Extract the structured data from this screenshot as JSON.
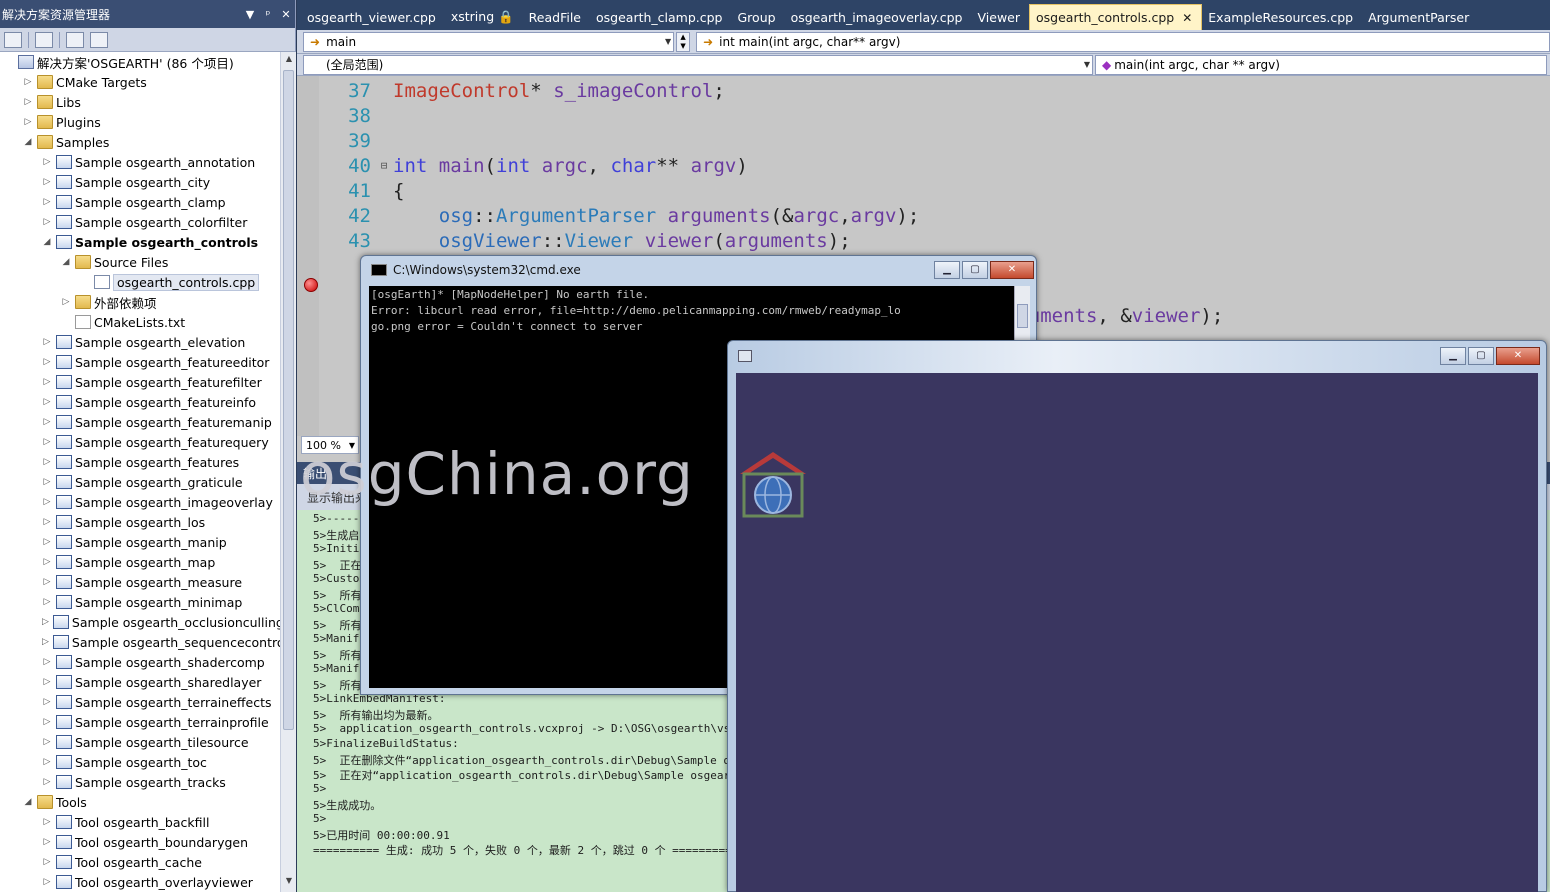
{
  "explorer": {
    "title": "解决方案资源管理器",
    "pin": "▼",
    "dock": "ᵖ",
    "close": "✕",
    "items": [
      {
        "text": "解决方案'OSGEARTH' (86 个项目)",
        "indent": 0,
        "arrow": "",
        "icon": "sln",
        "bold": false
      },
      {
        "text": "CMake Targets",
        "indent": 1,
        "arrow": "▷",
        "icon": "folder",
        "bold": false
      },
      {
        "text": "Libs",
        "indent": 1,
        "arrow": "▷",
        "icon": "folder",
        "bold": false
      },
      {
        "text": "Plugins",
        "indent": 1,
        "arrow": "▷",
        "icon": "folder",
        "bold": false
      },
      {
        "text": "Samples",
        "indent": 1,
        "arrow": "◢",
        "icon": "folder",
        "bold": false
      },
      {
        "text": "Sample osgearth_annotation",
        "indent": 2,
        "arrow": "▷",
        "icon": "proj",
        "bold": false
      },
      {
        "text": "Sample osgearth_city",
        "indent": 2,
        "arrow": "▷",
        "icon": "proj",
        "bold": false
      },
      {
        "text": "Sample osgearth_clamp",
        "indent": 2,
        "arrow": "▷",
        "icon": "proj",
        "bold": false
      },
      {
        "text": "Sample osgearth_colorfilter",
        "indent": 2,
        "arrow": "▷",
        "icon": "proj",
        "bold": false
      },
      {
        "text": "Sample osgearth_controls",
        "indent": 2,
        "arrow": "◢",
        "icon": "proj",
        "bold": true
      },
      {
        "text": "Source Files",
        "indent": 3,
        "arrow": "◢",
        "icon": "folder",
        "bold": false
      },
      {
        "text": "osgearth_controls.cpp",
        "indent": 4,
        "arrow": "",
        "icon": "cpp",
        "bold": false,
        "selected": true
      },
      {
        "text": "外部依赖项",
        "indent": 3,
        "arrow": "▷",
        "icon": "folder",
        "bold": false
      },
      {
        "text": "CMakeLists.txt",
        "indent": 3,
        "arrow": "",
        "icon": "txt",
        "bold": false
      },
      {
        "text": "Sample osgearth_elevation",
        "indent": 2,
        "arrow": "▷",
        "icon": "proj",
        "bold": false
      },
      {
        "text": "Sample osgearth_featureeditor",
        "indent": 2,
        "arrow": "▷",
        "icon": "proj",
        "bold": false
      },
      {
        "text": "Sample osgearth_featurefilter",
        "indent": 2,
        "arrow": "▷",
        "icon": "proj",
        "bold": false
      },
      {
        "text": "Sample osgearth_featureinfo",
        "indent": 2,
        "arrow": "▷",
        "icon": "proj",
        "bold": false
      },
      {
        "text": "Sample osgearth_featuremanip",
        "indent": 2,
        "arrow": "▷",
        "icon": "proj",
        "bold": false
      },
      {
        "text": "Sample osgearth_featurequery",
        "indent": 2,
        "arrow": "▷",
        "icon": "proj",
        "bold": false
      },
      {
        "text": "Sample osgearth_features",
        "indent": 2,
        "arrow": "▷",
        "icon": "proj",
        "bold": false
      },
      {
        "text": "Sample osgearth_graticule",
        "indent": 2,
        "arrow": "▷",
        "icon": "proj",
        "bold": false
      },
      {
        "text": "Sample osgearth_imageoverlay",
        "indent": 2,
        "arrow": "▷",
        "icon": "proj",
        "bold": false
      },
      {
        "text": "Sample osgearth_los",
        "indent": 2,
        "arrow": "▷",
        "icon": "proj",
        "bold": false
      },
      {
        "text": "Sample osgearth_manip",
        "indent": 2,
        "arrow": "▷",
        "icon": "proj",
        "bold": false
      },
      {
        "text": "Sample osgearth_map",
        "indent": 2,
        "arrow": "▷",
        "icon": "proj",
        "bold": false
      },
      {
        "text": "Sample osgearth_measure",
        "indent": 2,
        "arrow": "▷",
        "icon": "proj",
        "bold": false
      },
      {
        "text": "Sample osgearth_minimap",
        "indent": 2,
        "arrow": "▷",
        "icon": "proj",
        "bold": false
      },
      {
        "text": "Sample osgearth_occlusionculling",
        "indent": 2,
        "arrow": "▷",
        "icon": "proj",
        "bold": false
      },
      {
        "text": "Sample osgearth_sequencecontrol",
        "indent": 2,
        "arrow": "▷",
        "icon": "proj",
        "bold": false
      },
      {
        "text": "Sample osgearth_shadercomp",
        "indent": 2,
        "arrow": "▷",
        "icon": "proj",
        "bold": false
      },
      {
        "text": "Sample osgearth_sharedlayer",
        "indent": 2,
        "arrow": "▷",
        "icon": "proj",
        "bold": false
      },
      {
        "text": "Sample osgearth_terraineffects",
        "indent": 2,
        "arrow": "▷",
        "icon": "proj",
        "bold": false
      },
      {
        "text": "Sample osgearth_terrainprofile",
        "indent": 2,
        "arrow": "▷",
        "icon": "proj",
        "bold": false
      },
      {
        "text": "Sample osgearth_tilesource",
        "indent": 2,
        "arrow": "▷",
        "icon": "proj",
        "bold": false
      },
      {
        "text": "Sample osgearth_toc",
        "indent": 2,
        "arrow": "▷",
        "icon": "proj",
        "bold": false
      },
      {
        "text": "Sample osgearth_tracks",
        "indent": 2,
        "arrow": "▷",
        "icon": "proj",
        "bold": false
      },
      {
        "text": "Tools",
        "indent": 1,
        "arrow": "◢",
        "icon": "folder",
        "bold": false
      },
      {
        "text": "Tool osgearth_backfill",
        "indent": 2,
        "arrow": "▷",
        "icon": "proj",
        "bold": false
      },
      {
        "text": "Tool osgearth_boundarygen",
        "indent": 2,
        "arrow": "▷",
        "icon": "proj",
        "bold": false
      },
      {
        "text": "Tool osgearth_cache",
        "indent": 2,
        "arrow": "▷",
        "icon": "proj",
        "bold": false
      },
      {
        "text": "Tool osgearth_overlayviewer",
        "indent": 2,
        "arrow": "▷",
        "icon": "proj",
        "bold": false
      }
    ]
  },
  "editor": {
    "tabs": [
      {
        "label": "osgearth_viewer.cpp",
        "active": false
      },
      {
        "label": "xstring 🔒",
        "active": false
      },
      {
        "label": "ReadFile",
        "active": false
      },
      {
        "label": "osgearth_clamp.cpp",
        "active": false
      },
      {
        "label": "Group",
        "active": false
      },
      {
        "label": "osgearth_imageoverlay.cpp",
        "active": false
      },
      {
        "label": "Viewer",
        "active": false
      },
      {
        "label": "osgearth_controls.cpp",
        "active": true
      },
      {
        "label": "ExampleResources.cpp",
        "active": false
      },
      {
        "label": "ArgumentParser",
        "active": false
      }
    ],
    "close_glyph": "✕",
    "nav_left": "main",
    "nav_right": "int main(int argc, char** argv)",
    "scope_left": "(全局范围)",
    "scope_right": "main(int argc, char ** argv)",
    "zoom": "100 %",
    "code_lines": [
      {
        "n": "37",
        "text": "ImageControl* s_imageControl;"
      },
      {
        "n": "38",
        "text": ""
      },
      {
        "n": "39",
        "text": ""
      },
      {
        "n": "40",
        "text": "int main(int argc, char** argv)"
      },
      {
        "n": "41",
        "text": "{"
      },
      {
        "n": "42",
        "text": "    osg::ArgumentParser arguments(&argc,argv);"
      },
      {
        "n": "43",
        "text": "    osgViewer::Viewer viewer(arguments);"
      },
      {
        "n": "4",
        "text": ""
      },
      {
        "n": "4",
        "text": ""
      },
      {
        "n": "4",
        "text": "(arguments, &viewer);"
      },
      {
        "n": "4",
        "text": ""
      },
      {
        "n": "4",
        "text": ""
      },
      {
        "n": "4",
        "text": ""
      },
      {
        "n": "5",
        "text": ""
      }
    ]
  },
  "output": {
    "title": "输出",
    "show_label": "显示输出来",
    "lines": [
      "5>--------",
      "5>生成启",
      "5>Initia",
      "5>  正在",
      "5>Custom",
      "5>  所有",
      "5>ClComp",
      "5>  所有",
      "5>Manife",
      "5>  所有",
      "5>Manife",
      "5>  所有",
      "5>LinkEmbedManifest:",
      "5>  所有输出均为最新。",
      "5>  application_osgearth_controls.vcxproj -> D:\\OSG\\osgearth\\vs2010\\b",
      "5>FinalizeBuildStatus:",
      "5>  正在删除文件“application_osgearth_controls.dir\\Debug\\Sample osge",
      "5>  正在对“application_osgearth_controls.dir\\Debug\\Sample osgearth_c",
      "5>",
      "5>生成成功。",
      "5>",
      "5>已用时间 00:00:00.91",
      "========== 生成: 成功 5 个，失败 0 个，最新 2 个，跳过 0 个 =========="
    ]
  },
  "cmd": {
    "title": "C:\\Windows\\system32\\cmd.exe",
    "lines": [
      "[osgEarth]* [MapNodeHelper] No earth file.",
      "Error: libcurl read error, file=http://demo.pelicanmapping.com/rmweb/readymap_lo",
      "go.png error = Couldn't connect to server"
    ],
    "btn_min": "▁",
    "btn_max": "▢",
    "btn_close": "✕"
  },
  "viewer": {
    "btn_min": "▁",
    "btn_max": "▢",
    "btn_close": "✕",
    "canvas_color": "#3a3660"
  },
  "watermark": "osgChina.org"
}
